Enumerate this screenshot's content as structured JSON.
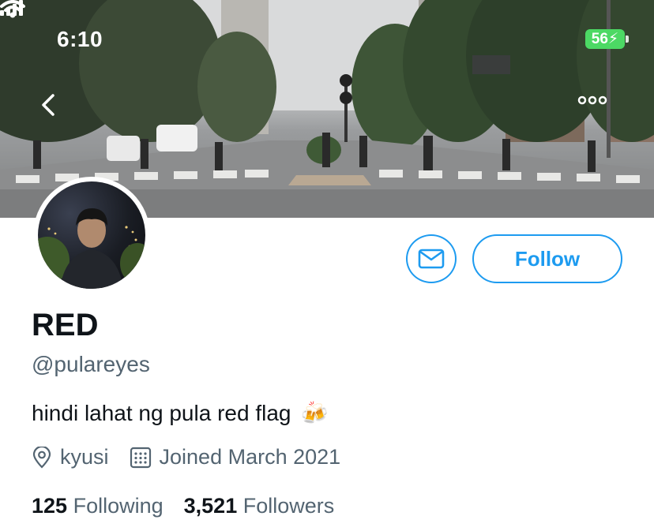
{
  "status_bar": {
    "time": "6:10",
    "battery_level": "56"
  },
  "banner": {
    "description_icon": "city-street-crosswalk-photo"
  },
  "header": {
    "back_icon": "chevron-left-icon",
    "more_icon": "more-horizontal-icon"
  },
  "profile": {
    "display_name": "RED",
    "handle": "@pulareyes",
    "bio": "hindi lahat ng pula red flag",
    "bio_emoji": "🍻",
    "location": "kyusi",
    "joined": "Joined March 2021",
    "following_count": "125",
    "following_label": "Following",
    "followers_count": "3,521",
    "followers_label": "Followers"
  },
  "actions": {
    "follow_label": "Follow",
    "message_icon": "mail-icon"
  },
  "colors": {
    "accent": "#1d9bf0",
    "secondary_text": "#536471",
    "primary_text": "#0f1419",
    "battery": "#4cd964"
  }
}
